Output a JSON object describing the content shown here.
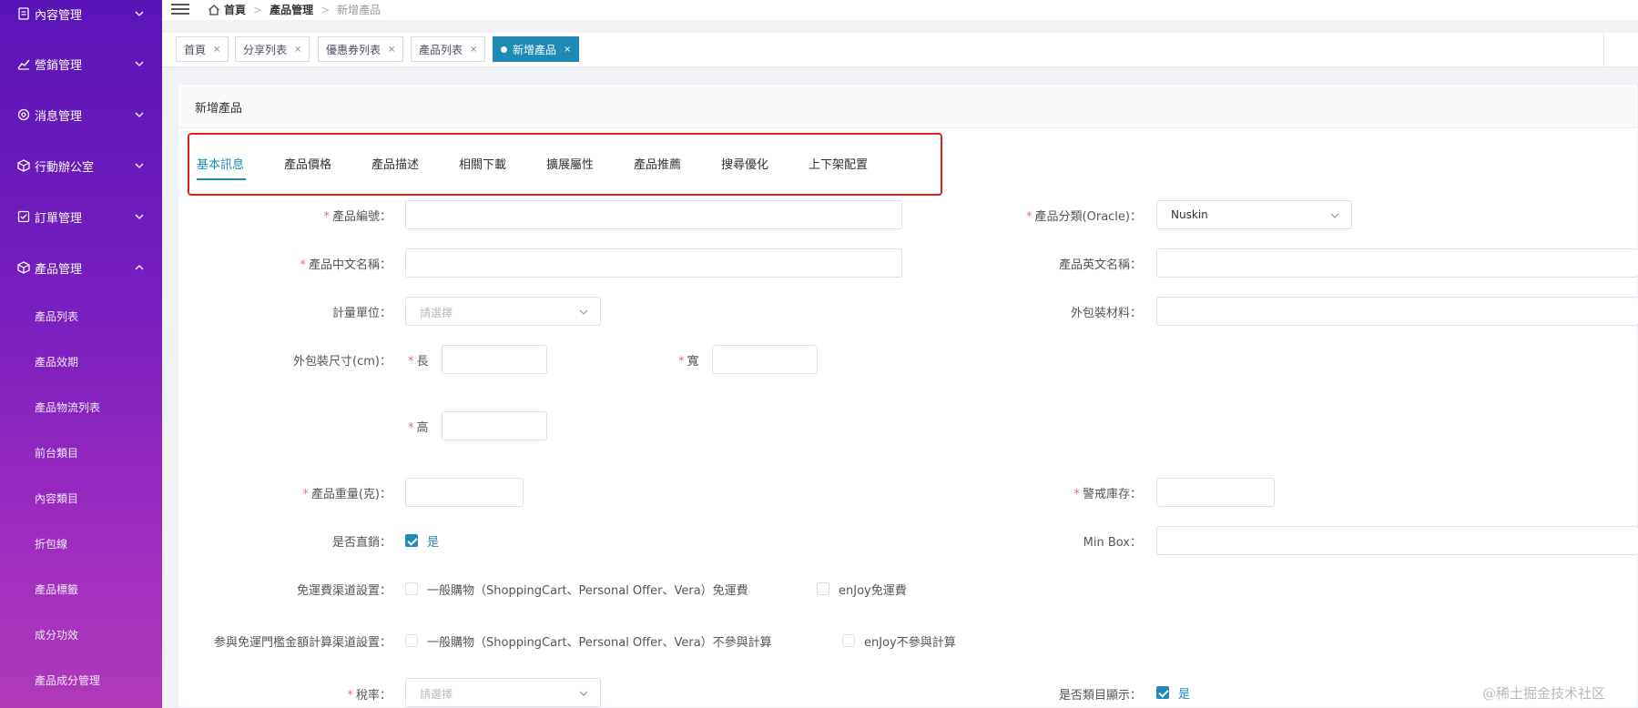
{
  "sidebar": {
    "groups": [
      {
        "label": "內容管理",
        "icon": "document-icon"
      },
      {
        "label": "營銷管理",
        "icon": "chart-icon"
      },
      {
        "label": "消息管理",
        "icon": "gear-icon"
      },
      {
        "label": "行動辦公室",
        "icon": "box-icon"
      },
      {
        "label": "訂單管理",
        "icon": "checklist-icon"
      },
      {
        "label": "產品管理",
        "icon": "box-icon",
        "expanded": true
      }
    ],
    "sub_items": [
      "產品列表",
      "產品效期",
      "產品物流列表",
      "前台類目",
      "內容類目",
      "折包線",
      "產品標籤",
      "成分功效",
      "產品成分管理"
    ]
  },
  "header": {
    "breadcrumb": [
      "首頁",
      "產品管理",
      "新增產品"
    ]
  },
  "tabs": [
    {
      "label": "首頁"
    },
    {
      "label": "分享列表"
    },
    {
      "label": "優惠券列表"
    },
    {
      "label": "產品列表"
    },
    {
      "label": "新增產品",
      "active": true
    }
  ],
  "tab_close": "×",
  "accent_color": "#1f8ab5",
  "card": {
    "title": "新增產品",
    "form_tabs": [
      "基本訊息",
      "產品價格",
      "產品描述",
      "相關下載",
      "擴展屬性",
      "產品推薦",
      "搜尋優化",
      "上下架配置"
    ]
  },
  "form": {
    "required_mark": "*",
    "product_no_label": "產品編號：",
    "category_label": "產品分類(Oracle)：",
    "category_value": "Nuskin",
    "cn_name_label": "產品中文名稱：",
    "en_name_label": "產品英文名稱：",
    "unit_label": "計量單位：",
    "unit_placeholder": "請選擇",
    "packaging_material_label": "外包裝材料：",
    "dimension_label": "外包裝尺寸(cm)：",
    "length_label": "長",
    "width_label": "寬",
    "height_label": "高",
    "weight_label": "產品重量(克)：",
    "stock_alert_label": "警戒庫存：",
    "direct_sale_label": "是否直銷：",
    "direct_sale_option": "是",
    "min_box_label": "Min Box：",
    "free_ship_label": "免運費渠道設置：",
    "free_ship_option1": "一般購物（ShoppingCart、Personal Offer、Vera）免運費",
    "free_ship_option2": "enJoy免運費",
    "threshold_label": "参與免運門檻金額計算渠道設置：",
    "threshold_option1": "一般購物（ShoppingCart、Personal Offer、Vera）不參與計算",
    "threshold_option2": "enJoy不參與計算",
    "tax_label": "稅率：",
    "tax_placeholder": "請選擇",
    "category_display_label": "是否類目顯示：",
    "category_display_option": "是"
  },
  "watermark": "@稀土掘金技术社区"
}
